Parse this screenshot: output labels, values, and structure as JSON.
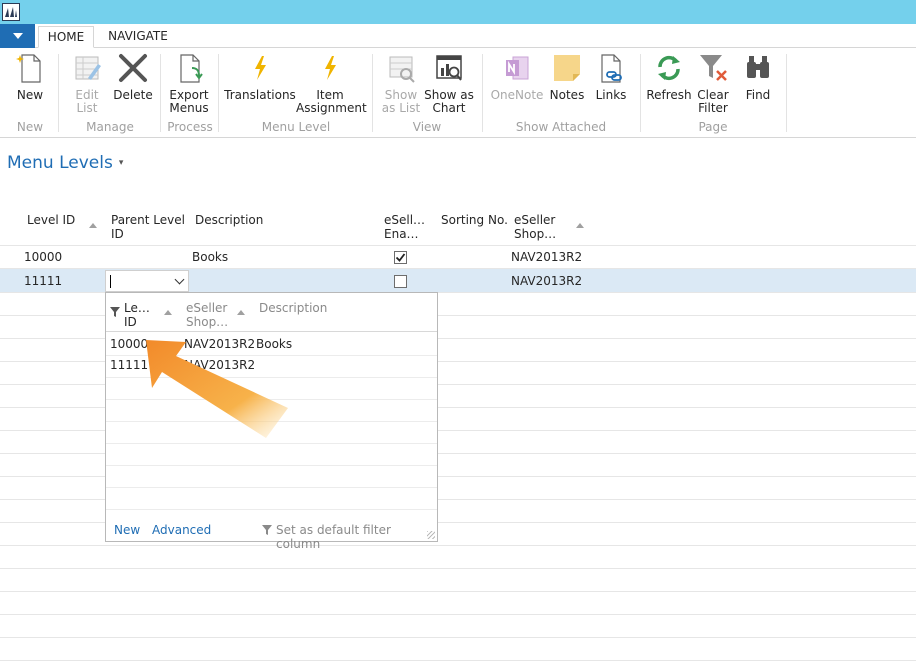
{
  "app": {
    "logo_icon": "dynamics-nav-logo-icon"
  },
  "tabs": [
    {
      "label": "HOME",
      "active": true
    },
    {
      "label": "NAVIGATE",
      "active": false
    }
  ],
  "ribbon": {
    "buttons": {
      "new": "New",
      "edit_list_1": "Edit",
      "edit_list_2": "List",
      "delete": "Delete",
      "export_1": "Export",
      "export_2": "Menus",
      "translations": "Translations",
      "item_assign_1": "Item",
      "item_assign_2": "Assignment",
      "show_list_1": "Show",
      "show_list_2": "as List",
      "show_chart_1": "Show as",
      "show_chart_2": "Chart",
      "onenote": "OneNote",
      "notes": "Notes",
      "links": "Links",
      "refresh": "Refresh",
      "clear_filter_1": "Clear",
      "clear_filter_2": "Filter",
      "find": "Find"
    },
    "groups": {
      "new": "New",
      "manage": "Manage",
      "process": "Process",
      "menu_level": "Menu Level",
      "view": "View",
      "show_attached": "Show Attached",
      "page": "Page"
    }
  },
  "page": {
    "title": "Menu Levels",
    "title_caret": "▾"
  },
  "grid": {
    "columns": {
      "level_id": "Level ID",
      "parent_level_1": "Parent Level",
      "parent_level_2": "ID",
      "description": "Description",
      "eseller_enabled_1": "eSell…",
      "eseller_enabled_2": "Ena…",
      "sorting_no": "Sorting No.",
      "eseller_shop_1": "eSeller",
      "eseller_shop_2": "Shop…"
    },
    "rows": [
      {
        "level_id": "10000",
        "description": "Books",
        "enabled": true,
        "shop": "NAV2013R2"
      },
      {
        "level_id": "11111",
        "description": "",
        "enabled": false,
        "shop": "NAV2013R2"
      }
    ]
  },
  "lookup": {
    "columns": {
      "level_1": "Le…",
      "level_2": "ID",
      "shop_1": "eSeller",
      "shop_2": "Shop…",
      "description": "Description"
    },
    "rows": [
      {
        "id": "10000",
        "shop": "NAV2013R2",
        "description": "Books"
      },
      {
        "id": "11111",
        "shop": "NAV2013R2",
        "description": ""
      }
    ],
    "footer": {
      "new": "New",
      "advanced": "Advanced",
      "default_filter": "Set as default filter column"
    }
  },
  "colors": {
    "accent": "#1f6db4",
    "titlebar": "#74d0ec",
    "selected_row": "#dbe9f5",
    "arrow": "#f5a534"
  }
}
